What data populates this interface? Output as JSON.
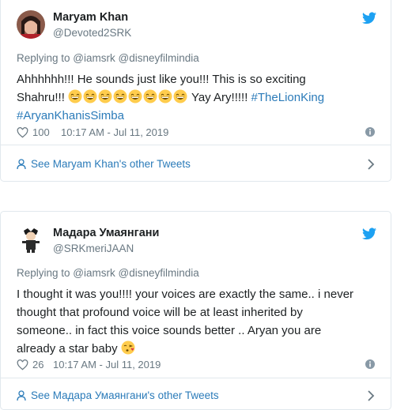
{
  "colors": {
    "link_blue": "#2b7bb9",
    "twitter_blue": "#1da1f2",
    "muted_gray": "#697882",
    "border": "#e1e8ed"
  },
  "tweets": [
    {
      "author_name": "Maryam Khan",
      "author_handle": "@Devoted2SRK",
      "avatar_icon": "profile-photo",
      "reply_prefix": "Replying to ",
      "reply_mentions": "@iamsrk @disneyfilmindia",
      "text_line1": "Ahhhhhh!!! He sounds just like you!!! This is so exciting",
      "text_shahru": "Shahru!!! ",
      "emoji_grin": "grinning-face-emoji",
      "text_yay": "Yay Ary!!!!! ",
      "hashtag1": "#TheLionKing",
      "hashtag2": "#AryanKhanisSimba",
      "likes": "100",
      "timestamp": "10:17 AM - Jul 11, 2019",
      "see_more": "See Maryam Khan's other Tweets"
    },
    {
      "author_name": "Мадара Умаянгани",
      "author_handle": "@SRKmeriJAAN",
      "avatar_icon": "character-avatar",
      "reply_prefix": "Replying to ",
      "reply_mentions": "@iamsrk @disneyfilmindia",
      "text_line1": "I thought it was you!!!! your voices are exactly the same.. i never",
      "text_line2": "thought that profound voice will be at least inherited by",
      "text_line3": "someone.. in fact this voice sounds better .. Aryan you are",
      "text_line4": "already a star baby ",
      "emoji_kiss": "face-blowing-kiss-emoji",
      "likes": "26",
      "timestamp": "10:17 AM - Jul 11, 2019",
      "see_more": "See Мадара Умаянгани's other Tweets"
    }
  ]
}
